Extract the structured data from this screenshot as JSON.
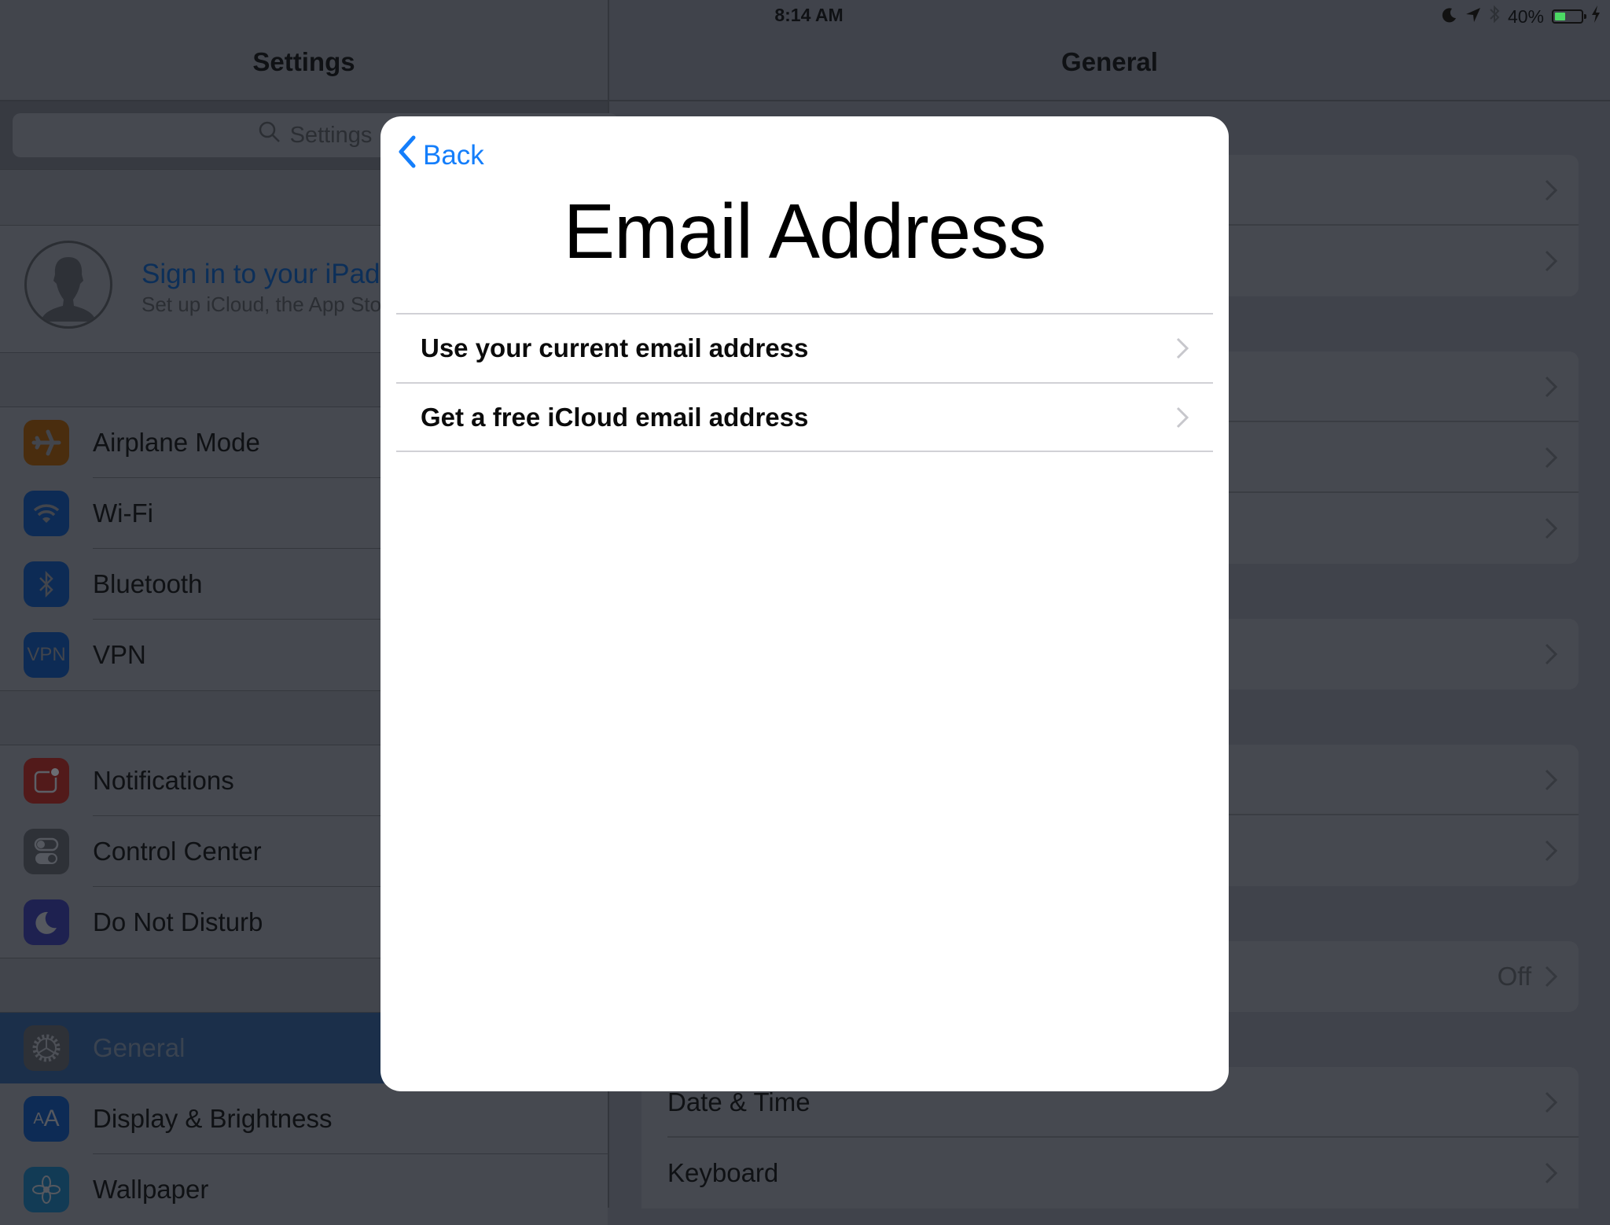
{
  "status_bar": {
    "device": "iPad",
    "time": "8:14 AM",
    "battery_text": "40%",
    "battery_level": 0.4,
    "icons": [
      "wifi-icon",
      "moon-icon",
      "location-arrow-icon",
      "bluetooth-icon",
      "battery-icon",
      "charging-bolt-icon"
    ]
  },
  "sidebar": {
    "title": "Settings",
    "search_placeholder": "Settings",
    "profile": {
      "title": "Sign in to your iPad",
      "subtitle": "Set up iCloud, the App Store, and more."
    },
    "groups": [
      [
        {
          "label": "Airplane Mode",
          "icon": "airplane-icon",
          "color": "#4a2d0e"
        },
        {
          "label": "Wi-Fi",
          "icon": "wifi-icon",
          "color": "#0d2b55"
        },
        {
          "label": "Bluetooth",
          "icon": "bluetooth-icon",
          "color": "#0d2b55"
        },
        {
          "label": "VPN",
          "icon": "vpn-icon",
          "color": "#0d2b55",
          "glyph": "VPN"
        }
      ],
      [
        {
          "label": "Notifications",
          "icon": "notifications-icon",
          "color": "#521a1a"
        },
        {
          "label": "Control Center",
          "icon": "control-center-icon",
          "color": "#2e3137"
        },
        {
          "label": "Do Not Disturb",
          "icon": "moon-icon",
          "color": "#1e2150"
        }
      ],
      [
        {
          "label": "General",
          "icon": "gear-icon",
          "color": "#2e3137",
          "selected": true
        },
        {
          "label": "Display & Brightness",
          "icon": "display-brightness-icon",
          "color": "#0d2b55",
          "glyph": "AA"
        },
        {
          "label": "Wallpaper",
          "icon": "wallpaper-flower-icon",
          "color": "#123b55"
        }
      ]
    ]
  },
  "detail": {
    "title": "General",
    "visible_rows": {
      "off_value": "Off",
      "date_time": "Date & Time",
      "keyboard": "Keyboard"
    }
  },
  "modal": {
    "back_label": "Back",
    "title": "Email Address",
    "options": [
      {
        "label": "Use your current email address"
      },
      {
        "label": "Get a free iCloud email address"
      }
    ],
    "accent_color": "#147efb"
  }
}
